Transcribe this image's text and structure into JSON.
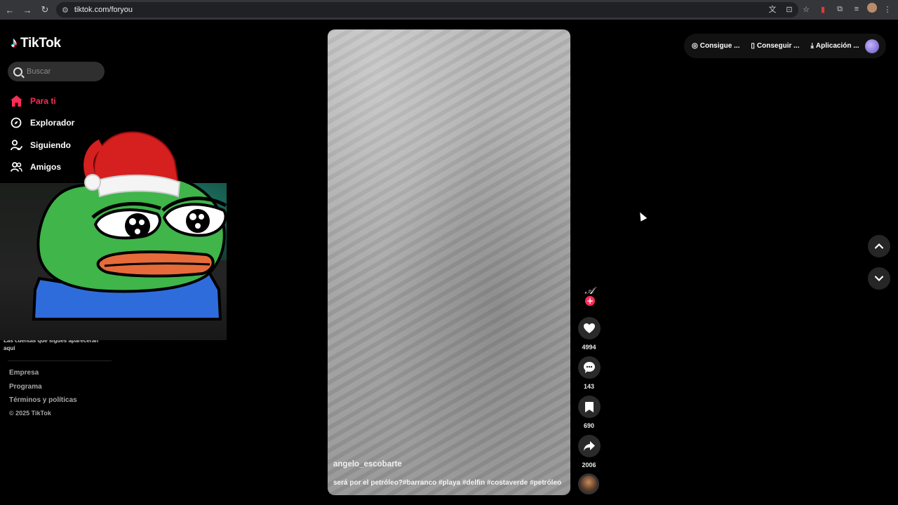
{
  "browser": {
    "url": "tiktok.com/foryou",
    "back_icon": "arrow-left-icon",
    "forward_icon": "arrow-right-icon",
    "reload_icon": "reload-icon"
  },
  "sidebar": {
    "logo_text": "TikTok",
    "search_placeholder": "Buscar",
    "nav": [
      {
        "label": "Para ti",
        "icon": "home-icon",
        "active": true
      },
      {
        "label": "Explorador",
        "icon": "compass-icon"
      },
      {
        "label": "Siguiendo",
        "icon": "following-icon"
      },
      {
        "label": "Amigos",
        "icon": "friends-icon"
      }
    ],
    "follow_note": "Las cuentas que sigues aparecerán aquí",
    "footer": [
      "Empresa",
      "Programa",
      "Términos y políticas"
    ],
    "copyright": "© 2025 TikTok"
  },
  "video": {
    "author": "angelo_escobarte",
    "caption": "será por el petróleo?#barranco #playa #delfin #costaverde #petróleo"
  },
  "actions": {
    "likes": "4994",
    "comments": "143",
    "saves": "690",
    "shares": "2006"
  },
  "topbar": {
    "coins": "Consigue ...",
    "app": "Conseguir ...",
    "download": "Aplicación ..."
  },
  "colors": {
    "accent": "#fe2c55",
    "background": "#000000"
  }
}
